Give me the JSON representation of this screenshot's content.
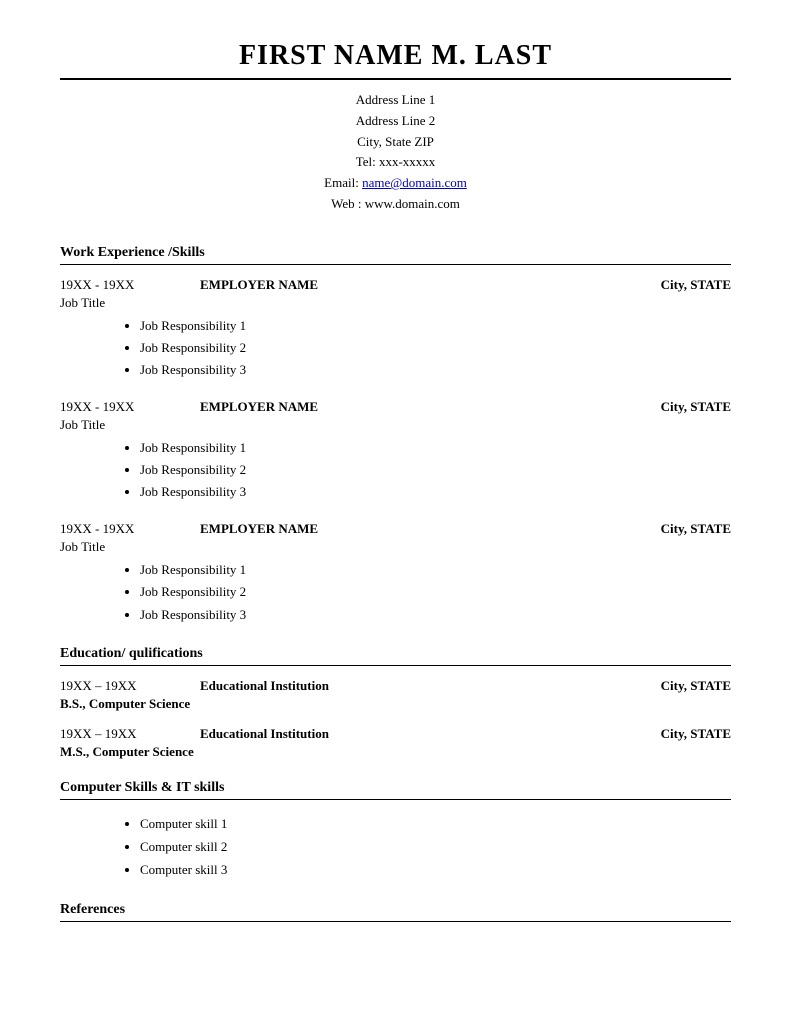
{
  "header": {
    "full_name": "FIRST NAME M. LAST",
    "address_line1": "Address Line 1",
    "address_line2": "Address Line 2",
    "city_state_zip": "City, State ZIP",
    "tel": "Tel: xxx-xxxxx",
    "email_label": "Email:",
    "email_address": "name@domain.com",
    "email_href": "mailto:name@domain.com",
    "web_label": "Web : www.domain.com"
  },
  "sections": {
    "work_experience": {
      "title": "Work Experience /Skills",
      "jobs": [
        {
          "dates": "19XX - 19XX",
          "employer": "EMPLOYER NAME",
          "location": "City, STATE",
          "title": "Job Title",
          "responsibilities": [
            "Job Responsibility 1",
            "Job Responsibility 2",
            "Job Responsibility 3"
          ]
        },
        {
          "dates": "19XX - 19XX",
          "employer": "EMPLOYER NAME",
          "location": "City, STATE",
          "title": "Job Title",
          "responsibilities": [
            "Job Responsibility 1",
            "Job Responsibility 2",
            "Job Responsibility 3"
          ]
        },
        {
          "dates": "19XX - 19XX",
          "employer": "EMPLOYER NAME",
          "location": "City, STATE",
          "title": "Job Title",
          "responsibilities": [
            "Job Responsibility 1",
            "Job Responsibility 2",
            "Job Responsibility 3"
          ]
        }
      ]
    },
    "education": {
      "title": "Education/ qulifications",
      "entries": [
        {
          "dates": "19XX – 19XX",
          "institution": "Educational Institution",
          "location": "City, STATE",
          "degree": "B.S., Computer Science"
        },
        {
          "dates": "19XX – 19XX",
          "institution": "Educational Institution",
          "location": "City, STATE",
          "degree": "M.S., Computer Science"
        }
      ]
    },
    "computer_skills": {
      "title": "Computer Skills & IT skills",
      "skills": [
        "Computer skill 1",
        "Computer skill 2",
        "Computer skill 3"
      ]
    },
    "references": {
      "title": "References"
    }
  }
}
